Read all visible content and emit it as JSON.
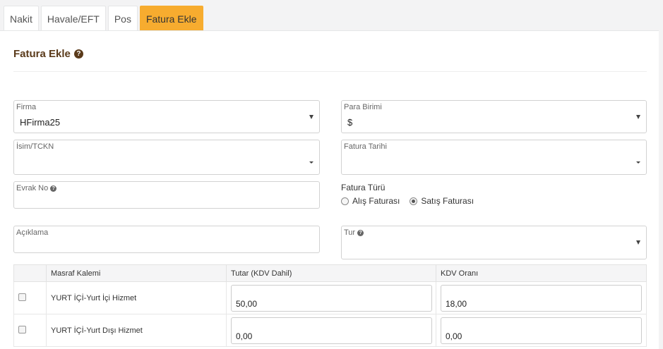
{
  "tabs": [
    {
      "label": "Nakit"
    },
    {
      "label": "Havale/EFT"
    },
    {
      "label": "Pos"
    },
    {
      "label": "Fatura Ekle"
    }
  ],
  "form": {
    "title": "Fatura Ekle",
    "firma": {
      "label": "Firma",
      "value": "HFirma25"
    },
    "para_birimi": {
      "label": "Para Birimi",
      "value": "$"
    },
    "isim_tckn": {
      "label": "İsim/TCKN",
      "value": ""
    },
    "fatura_tarihi": {
      "label": "Fatura Tarihi",
      "value": ""
    },
    "evrak_no": {
      "label": "Evrak No",
      "value": ""
    },
    "fatura_turu": {
      "label": "Fatura Türü",
      "options": [
        "Alış Faturası",
        "Satış Faturası"
      ],
      "selected": "Satış Faturası"
    },
    "aciklama": {
      "label": "Açıklama",
      "value": ""
    },
    "tur": {
      "label": "Tur",
      "value": ""
    }
  },
  "table": {
    "headers": [
      "",
      "Masraf Kalemi",
      "Tutar (KDV Dahil)",
      "KDV Oranı"
    ],
    "rows": [
      {
        "kalem": "YURT İÇİ-Yurt İçi Hizmet",
        "tutar": "50,00",
        "kdv": "18,00"
      },
      {
        "kalem": "YURT İÇİ-Yurt Dışı Hizmet",
        "tutar": "0,00",
        "kdv": "0,00"
      }
    ]
  }
}
